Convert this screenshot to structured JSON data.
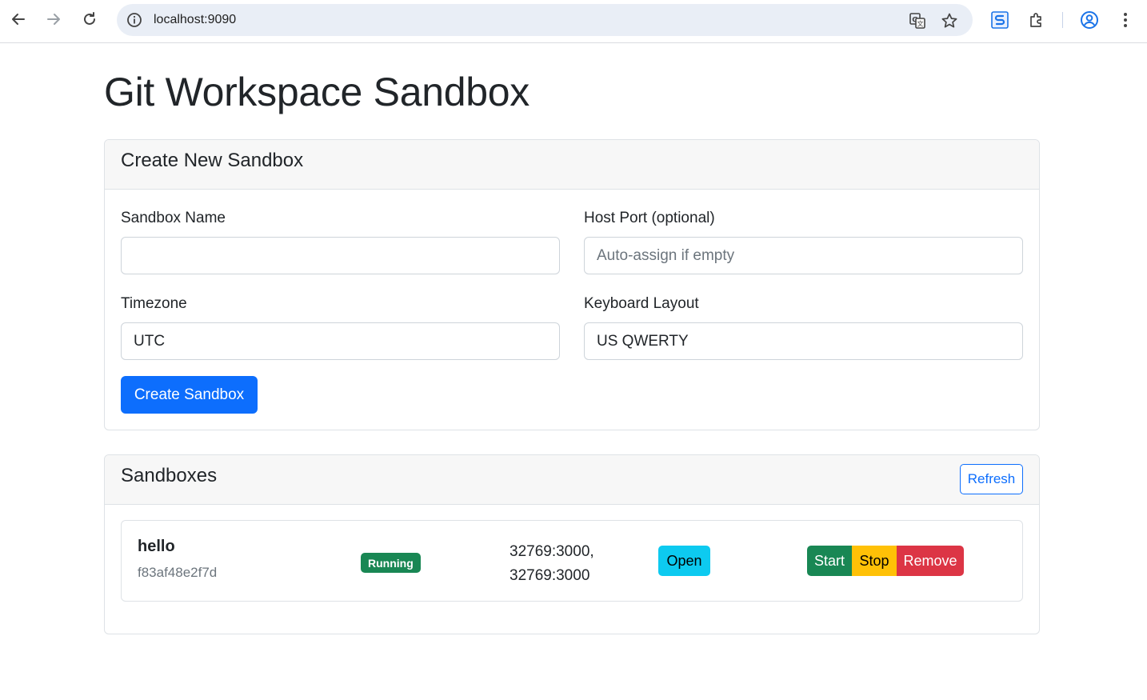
{
  "browser": {
    "url": "localhost:9090",
    "icons": [
      "back-arrow-icon",
      "forward-arrow-icon",
      "reload-icon",
      "site-info-icon",
      "translate-icon",
      "bookmark-star-icon",
      "extension-s-icon",
      "puzzle-extensions-icon",
      "profile-icon",
      "kebab-menu-icon"
    ]
  },
  "page": {
    "title": "Git Workspace Sandbox"
  },
  "create": {
    "header": "Create New Sandbox",
    "name_label": "Sandbox Name",
    "name_value": "",
    "port_label": "Host Port (optional)",
    "port_placeholder": "Auto-assign if empty",
    "tz_label": "Timezone",
    "tz_value": "UTC",
    "kb_label": "Keyboard Layout",
    "kb_value": "US QWERTY",
    "submit_label": "Create Sandbox"
  },
  "list": {
    "header": "Sandboxes",
    "refresh_label": "Refresh",
    "items": [
      {
        "name": "hello",
        "id": "f83af48e2f7d",
        "status": "Running",
        "ports_line1": "32769:3000,",
        "ports_line2": "32769:3000",
        "open_label": "Open",
        "start_label": "Start",
        "stop_label": "Stop",
        "remove_label": "Remove"
      }
    ]
  },
  "colors": {
    "primary": "#0d6efd",
    "success": "#198754",
    "warning": "#ffc107",
    "danger": "#dc3545",
    "info": "#0dcaf0"
  }
}
